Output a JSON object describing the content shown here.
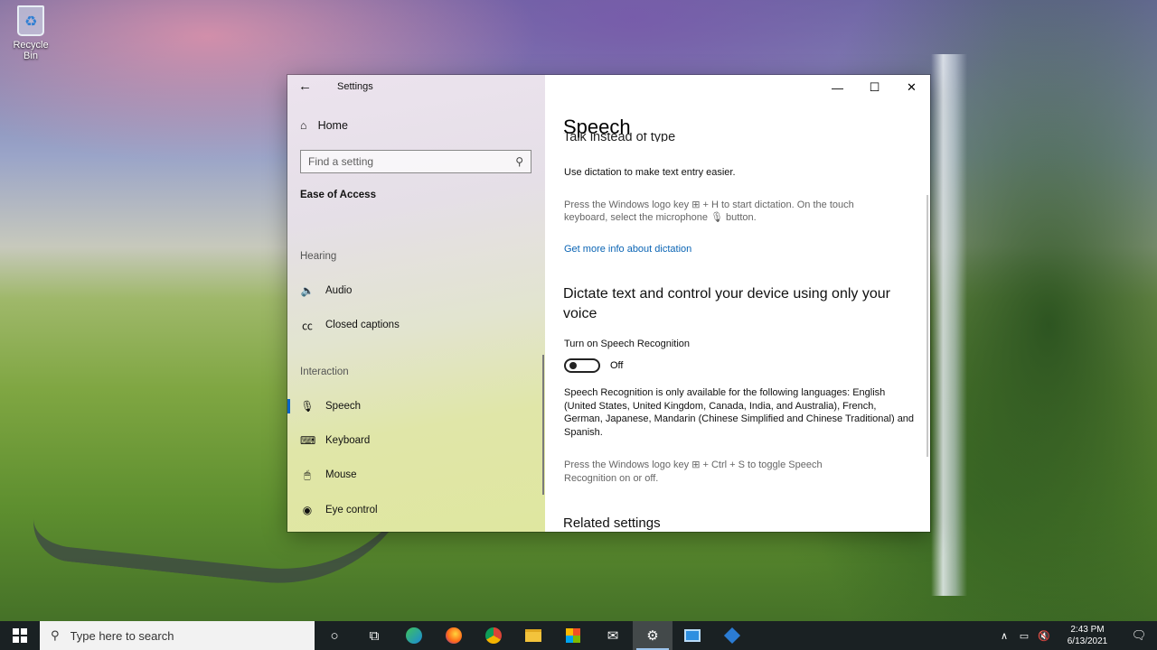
{
  "desktop": {
    "recycle_bin_label": "Recycle Bin"
  },
  "window": {
    "app_title": "Settings",
    "controls": {
      "minimize": "—",
      "maximize": "☐",
      "close": "✕"
    }
  },
  "nav": {
    "home_label": "Home",
    "search_placeholder": "Find a setting",
    "section_title": "Ease of Access",
    "groups": [
      {
        "label": "Hearing",
        "items": [
          {
            "label": "Audio",
            "icon": "speaker-icon"
          },
          {
            "label": "Closed captions",
            "icon": "captions-icon"
          }
        ]
      },
      {
        "label": "Interaction",
        "items": [
          {
            "label": "Speech",
            "icon": "microphone-icon",
            "selected": true
          },
          {
            "label": "Keyboard",
            "icon": "keyboard-icon"
          },
          {
            "label": "Mouse",
            "icon": "mouse-icon"
          },
          {
            "label": "Eye control",
            "icon": "eye-control-icon"
          }
        ]
      }
    ]
  },
  "content": {
    "page_title": "Speech",
    "cut_heading": "Talk instead of type",
    "intro": "Use dictation to make text entry easier.",
    "dictation_hint_1": "Press the Windows logo key ⊞ + H to start dictation.  On the touch",
    "dictation_hint_2": "keyboard, select the microphone 🎙 button.",
    "more_info_link": "Get more info about dictation",
    "section2_title": "Dictate text and control your device using only your voice",
    "toggle_label": "Turn on Speech Recognition",
    "toggle_state": "Off",
    "languages_note": "Speech Recognition is only available for the following languages: English (United States, United Kingdom, Canada, India, and Australia), French, German, Japanese, Mandarin (Chinese Simplified and Chinese Traditional) and Spanish.",
    "toggle_hint": "Press the Windows logo key ⊞ + Ctrl + S to toggle Speech Recognition on or off.",
    "related_title": "Related settings"
  },
  "taskbar": {
    "search_placeholder": "Type here to search",
    "pinned": [
      "cortana-icon",
      "task-view-icon",
      "edge-icon",
      "firefox-icon",
      "chrome-icon",
      "file-explorer-icon",
      "store-icon",
      "mail-icon",
      "settings-icon",
      "control-panel-icon",
      "app-icon"
    ],
    "clock_time": "2:43 PM",
    "clock_date": "6/13/2021"
  }
}
